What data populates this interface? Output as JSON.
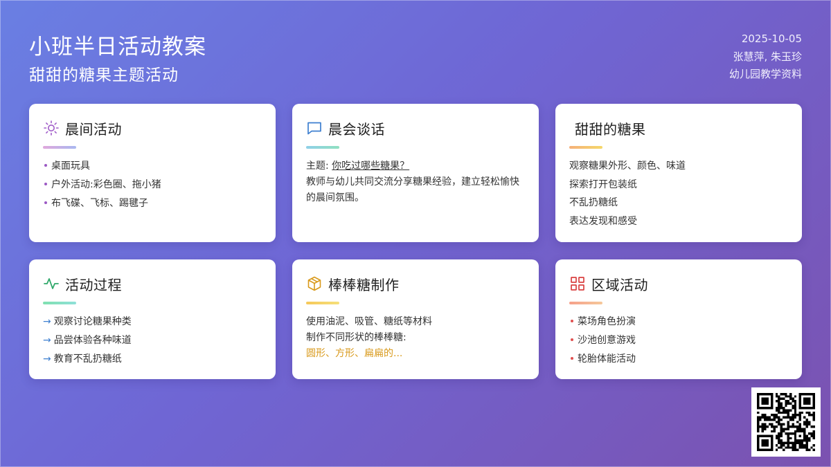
{
  "header": {
    "title": "小班半日活动教案",
    "subtitle": "甜甜的糖果主题活动",
    "date": "2025-10-05",
    "authors": "张慧萍, 朱玉珍",
    "source": "幼儿园教学资料"
  },
  "cards": {
    "morning_activity": {
      "title": "晨间活动",
      "icon": "sun-icon",
      "accent": "#d6a6e6",
      "items": [
        "桌面玩具",
        "户外活动:彩色圈、拖小猪",
        "布飞碟、飞标、踢毽子"
      ]
    },
    "morning_talk": {
      "title": "晨会谈话",
      "icon": "chat-bubble-icon",
      "accent": "#7fd3e0",
      "topic_label": "主题: ",
      "topic": "你吃过哪些糖果？",
      "text": "教师与幼儿共同交流分享糖果经验，建立轻松愉快的晨间氛围。"
    },
    "sweet_candy": {
      "title": "甜甜的糖果",
      "accent": "#f5c86a",
      "items": [
        "观察糖果外形、颜色、味道",
        "探索打开包装纸",
        "不乱扔糖纸",
        "表达发现和感受"
      ]
    },
    "process": {
      "title": "活动过程",
      "icon": "activity-pulse-icon",
      "accent": "#7fe0b8",
      "items": [
        "观察讨论糖果种类",
        "品尝体验各种味道",
        "教育不乱扔糖纸"
      ]
    },
    "lollipop": {
      "title": "棒棒糖制作",
      "icon": "box-icon",
      "accent": "#f5d36a",
      "line1": "使用油泥、吸管、糖纸等材料",
      "line2": "制作不同形状的棒棒糖:",
      "line3": "圆形、方形、扁扁的..."
    },
    "area": {
      "title": "区域活动",
      "icon": "grid-icon",
      "accent": "#f5a98a",
      "items": [
        "菜场角色扮演",
        "沙池创意游戏",
        "轮胎体能活动"
      ]
    }
  },
  "colors": {
    "purple_bullet": "#9b59c4",
    "blue_arrow": "#3d7fd0",
    "red_bullet": "#e05050",
    "orange_text": "#d99a1c"
  },
  "qr": {
    "icon": "qr-code-icon"
  }
}
